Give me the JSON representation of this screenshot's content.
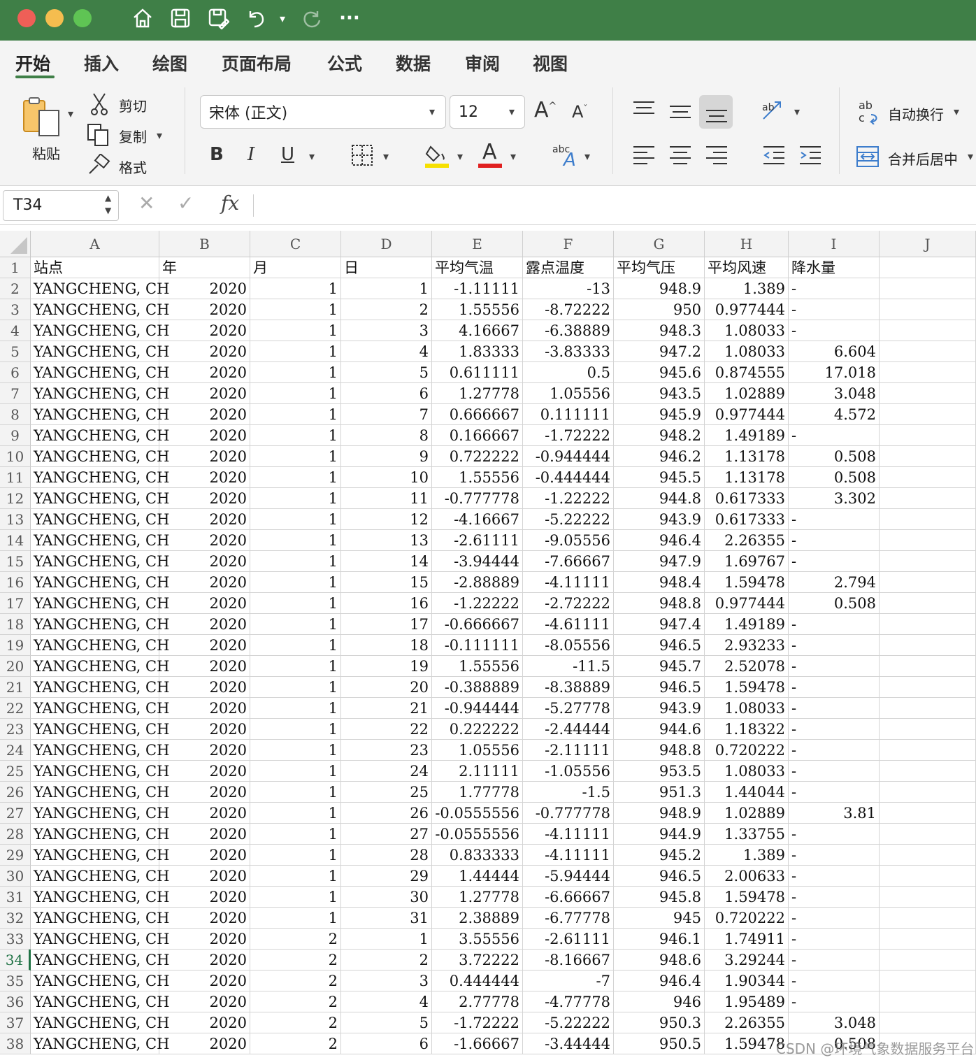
{
  "toolbar_icons": [
    "home-icon",
    "save-icon",
    "save-as-icon",
    "undo-icon",
    "redo-icon",
    "more-icon"
  ],
  "tabs": [
    {
      "label": "开始",
      "active": true
    },
    {
      "label": "插入"
    },
    {
      "label": "绘图"
    },
    {
      "label": "页面布局"
    },
    {
      "label": "公式"
    },
    {
      "label": "数据"
    },
    {
      "label": "审阅"
    },
    {
      "label": "视图"
    }
  ],
  "ribbon": {
    "paste_label": "粘贴",
    "cut_label": "剪切",
    "copy_label": "复制",
    "format_label": "格式",
    "font_name": "宋体 (正文)",
    "font_size": "12",
    "bold": "B",
    "italic": "I",
    "underline": "U",
    "font_color_glyph": "A",
    "wrap_label": "自动换行",
    "merge_label": "合并后居中",
    "highlight_color": "#f6e000",
    "font_color": "#e02020"
  },
  "formula_bar": {
    "cell_ref": "T34",
    "fx": "fx",
    "content": ""
  },
  "accent_color": "#3f7f47",
  "columns": [
    "A",
    "B",
    "C",
    "D",
    "E",
    "F",
    "G",
    "H",
    "I",
    "J"
  ],
  "selected_row": 34,
  "rows": [
    [
      "站点",
      "年",
      "月",
      "日",
      "平均气温",
      "露点温度",
      "平均气压",
      "平均风速",
      "降水量"
    ],
    [
      "YANGCHENG, CH",
      "2020",
      "1",
      "1",
      "-1.11111",
      "-13",
      "948.9",
      "1.389",
      "-"
    ],
    [
      "YANGCHENG, CH",
      "2020",
      "1",
      "2",
      "1.55556",
      "-8.72222",
      "950",
      "0.977444",
      "-"
    ],
    [
      "YANGCHENG, CH",
      "2020",
      "1",
      "3",
      "4.16667",
      "-6.38889",
      "948.3",
      "1.08033",
      "-"
    ],
    [
      "YANGCHENG, CH",
      "2020",
      "1",
      "4",
      "1.83333",
      "-3.83333",
      "947.2",
      "1.08033",
      "6.604"
    ],
    [
      "YANGCHENG, CH",
      "2020",
      "1",
      "5",
      "0.611111",
      "0.5",
      "945.6",
      "0.874555",
      "17.018"
    ],
    [
      "YANGCHENG, CH",
      "2020",
      "1",
      "6",
      "1.27778",
      "1.05556",
      "943.5",
      "1.02889",
      "3.048"
    ],
    [
      "YANGCHENG, CH",
      "2020",
      "1",
      "7",
      "0.666667",
      "0.111111",
      "945.9",
      "0.977444",
      "4.572"
    ],
    [
      "YANGCHENG, CH",
      "2020",
      "1",
      "8",
      "0.166667",
      "-1.72222",
      "948.2",
      "1.49189",
      "-"
    ],
    [
      "YANGCHENG, CH",
      "2020",
      "1",
      "9",
      "0.722222",
      "-0.944444",
      "946.2",
      "1.13178",
      "0.508"
    ],
    [
      "YANGCHENG, CH",
      "2020",
      "1",
      "10",
      "1.55556",
      "-0.444444",
      "945.5",
      "1.13178",
      "0.508"
    ],
    [
      "YANGCHENG, CH",
      "2020",
      "1",
      "11",
      "-0.777778",
      "-1.22222",
      "944.8",
      "0.617333",
      "3.302"
    ],
    [
      "YANGCHENG, CH",
      "2020",
      "1",
      "12",
      "-4.16667",
      "-5.22222",
      "943.9",
      "0.617333",
      "-"
    ],
    [
      "YANGCHENG, CH",
      "2020",
      "1",
      "13",
      "-2.61111",
      "-9.05556",
      "946.4",
      "2.26355",
      "-"
    ],
    [
      "YANGCHENG, CH",
      "2020",
      "1",
      "14",
      "-3.94444",
      "-7.66667",
      "947.9",
      "1.69767",
      "-"
    ],
    [
      "YANGCHENG, CH",
      "2020",
      "1",
      "15",
      "-2.88889",
      "-4.11111",
      "948.4",
      "1.59478",
      "2.794"
    ],
    [
      "YANGCHENG, CH",
      "2020",
      "1",
      "16",
      "-1.22222",
      "-2.72222",
      "948.8",
      "0.977444",
      "0.508"
    ],
    [
      "YANGCHENG, CH",
      "2020",
      "1",
      "17",
      "-0.666667",
      "-4.61111",
      "947.4",
      "1.49189",
      "-"
    ],
    [
      "YANGCHENG, CH",
      "2020",
      "1",
      "18",
      "-0.111111",
      "-8.05556",
      "946.5",
      "2.93233",
      "-"
    ],
    [
      "YANGCHENG, CH",
      "2020",
      "1",
      "19",
      "1.55556",
      "-11.5",
      "945.7",
      "2.52078",
      "-"
    ],
    [
      "YANGCHENG, CH",
      "2020",
      "1",
      "20",
      "-0.388889",
      "-8.38889",
      "946.5",
      "1.59478",
      "-"
    ],
    [
      "YANGCHENG, CH",
      "2020",
      "1",
      "21",
      "-0.944444",
      "-5.27778",
      "943.9",
      "1.08033",
      "-"
    ],
    [
      "YANGCHENG, CH",
      "2020",
      "1",
      "22",
      "0.222222",
      "-2.44444",
      "944.6",
      "1.18322",
      "-"
    ],
    [
      "YANGCHENG, CH",
      "2020",
      "1",
      "23",
      "1.05556",
      "-2.11111",
      "948.8",
      "0.720222",
      "-"
    ],
    [
      "YANGCHENG, CH",
      "2020",
      "1",
      "24",
      "2.11111",
      "-1.05556",
      "953.5",
      "1.08033",
      "-"
    ],
    [
      "YANGCHENG, CH",
      "2020",
      "1",
      "25",
      "1.77778",
      "-1.5",
      "951.3",
      "1.44044",
      "-"
    ],
    [
      "YANGCHENG, CH",
      "2020",
      "1",
      "26",
      "-0.0555556",
      "-0.777778",
      "948.9",
      "1.02889",
      "3.81"
    ],
    [
      "YANGCHENG, CH",
      "2020",
      "1",
      "27",
      "-0.0555556",
      "-4.11111",
      "944.9",
      "1.33755",
      "-"
    ],
    [
      "YANGCHENG, CH",
      "2020",
      "1",
      "28",
      "0.833333",
      "-4.11111",
      "945.2",
      "1.389",
      "-"
    ],
    [
      "YANGCHENG, CH",
      "2020",
      "1",
      "29",
      "1.44444",
      "-5.94444",
      "946.5",
      "2.00633",
      "-"
    ],
    [
      "YANGCHENG, CH",
      "2020",
      "1",
      "30",
      "1.27778",
      "-6.66667",
      "945.8",
      "1.59478",
      "-"
    ],
    [
      "YANGCHENG, CH",
      "2020",
      "1",
      "31",
      "2.38889",
      "-6.77778",
      "945",
      "0.720222",
      "-"
    ],
    [
      "YANGCHENG, CH",
      "2020",
      "2",
      "1",
      "3.55556",
      "-2.61111",
      "946.1",
      "1.74911",
      "-"
    ],
    [
      "YANGCHENG, CH",
      "2020",
      "2",
      "2",
      "3.72222",
      "-8.16667",
      "948.6",
      "3.29244",
      "-"
    ],
    [
      "YANGCHENG, CH",
      "2020",
      "2",
      "3",
      "0.444444",
      "-7",
      "946.4",
      "1.90344",
      "-"
    ],
    [
      "YANGCHENG, CH",
      "2020",
      "2",
      "4",
      "2.77778",
      "-4.77778",
      "946",
      "1.95489",
      "-"
    ],
    [
      "YANGCHENG, CH",
      "2020",
      "2",
      "5",
      "-1.72222",
      "-5.22222",
      "950.3",
      "2.26355",
      "3.048"
    ],
    [
      "YANGCHENG, CH",
      "2020",
      "2",
      "6",
      "-1.66667",
      "-3.44444",
      "950.5",
      "1.59478",
      "0.508"
    ]
  ],
  "watermark": "CSDN @环境气象数据服务平台"
}
